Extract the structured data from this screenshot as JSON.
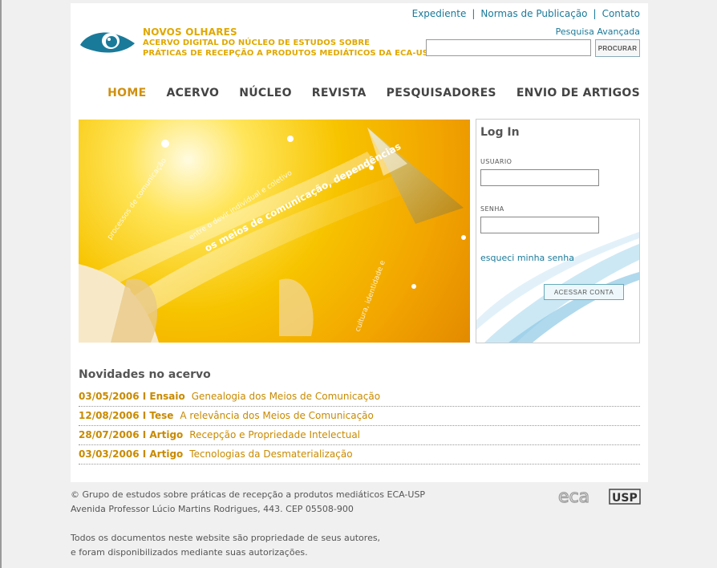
{
  "header": {
    "top_links": [
      "Expediente",
      "Normas de Publicação",
      "Contato"
    ],
    "brand_title": "NOVOS OLHARES",
    "brand_line1": "ACERVO DIGITAL DO NÚCLEO DE ESTUDOS SOBRE",
    "brand_line2": "PRÁTICAS DE RECEPÇÃO A PRODUTOS MEDIÁTICOS DA ECA-USP",
    "advanced_search": "Pesquisa Avançada",
    "search_value": "",
    "search_button": "PROCURAR"
  },
  "nav": {
    "items": [
      "HOME",
      "ACERVO",
      "NÚCLEO",
      "REVISTA",
      "PESQUISADORES",
      "ENVIO DE ARTIGOS"
    ],
    "active": "HOME"
  },
  "hero": {
    "arc_texts": [
      "processos de comunicação",
      "entre o devir individual e coletivo",
      "os meios de comunicação, dependências",
      "cultura, identidade e"
    ]
  },
  "login": {
    "title": "Log In",
    "user_label": "USUARIO",
    "user_value": "",
    "password_label": "SENHA",
    "password_value": "",
    "forgot": "esqueci minha senha",
    "submit": "ACESSAR CONTA"
  },
  "news": {
    "title": "Novidades no acervo",
    "items": [
      {
        "meta": "03/05/2006 I Ensaio",
        "title": "Genealogia dos Meios de Comunicação"
      },
      {
        "meta": "12/08/2006 I Tese",
        "title": "A relevância dos Meios de Comunicação"
      },
      {
        "meta": "28/07/2006 I Artigo",
        "title": "Recepção e Propriedade Intelectual"
      },
      {
        "meta": "03/03/2006 I Artigo",
        "title": "Tecnologias da Desmaterialização"
      }
    ]
  },
  "footer": {
    "line1": "© Grupo de estudos sobre práticas de recepção a produtos mediáticos ECA-USP",
    "line2": "Avenida Professor Lúcio Martins Rodrigues, 443. CEP 05508-900",
    "line3": "Todos os documentos neste website são propriedade de seus autores,",
    "line4": "e foram disponibilizados mediante suas autorizações.",
    "logo_eca": "eca",
    "logo_usp": "USP"
  },
  "colors": {
    "accent": "#d09010",
    "link": "#1a7a9a"
  }
}
